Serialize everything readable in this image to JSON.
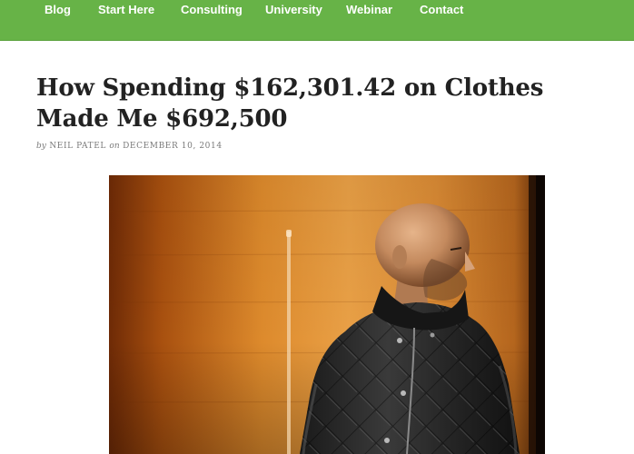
{
  "nav": {
    "items": [
      {
        "label": "Blog"
      },
      {
        "label": "Start Here"
      },
      {
        "label": "Consulting"
      },
      {
        "label": "University"
      },
      {
        "label": "Webinar"
      },
      {
        "label": "Contact"
      }
    ]
  },
  "post": {
    "title": "How Spending $162,301.42 on Clothes Made Me $692,500",
    "byline": {
      "by": "by",
      "author": "NEIL PATEL",
      "on": "on",
      "date": "DECEMBER 10, 2014"
    }
  },
  "colors": {
    "nav_background": "#67b347",
    "title_text": "#222222",
    "meta_text": "#7a7a7a"
  }
}
